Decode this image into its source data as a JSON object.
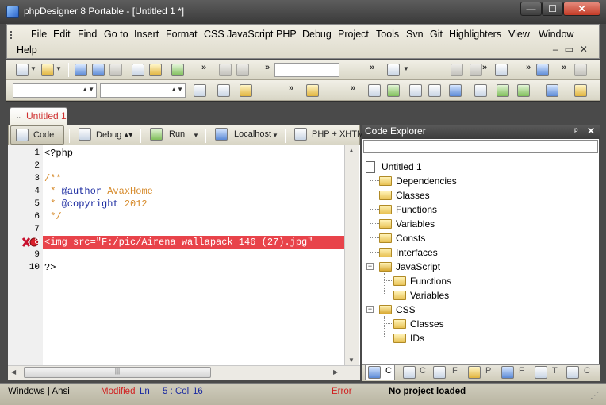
{
  "window": {
    "title": "phpDesigner 8 Portable - [Untitled 1 *]"
  },
  "menu": {
    "items": [
      "File",
      "Edit",
      "Find",
      "Go to",
      "Insert",
      "Format",
      "CSS",
      "JavaScript",
      "PHP",
      "Debug",
      "Project",
      "Tools",
      "Svn",
      "Git",
      "Highlighters",
      "View",
      "Window"
    ],
    "help": "Help"
  },
  "doc_tab": {
    "label": "Untitled 1"
  },
  "editor_toolbar": {
    "code": "Code",
    "debug": "Debug",
    "run": "Run",
    "localhost": "Localhost",
    "php_xhtml": "PHP + XHTM"
  },
  "editor": {
    "line_numbers": [
      "1",
      "2",
      "3",
      "4",
      "5",
      "6",
      "7",
      "8",
      "9",
      "10"
    ],
    "lines": [
      "<?php",
      "",
      "/**",
      " * @author AvaxHome",
      " * @copyright 2012",
      " */",
      "",
      "<img src=\"F:/pic/Airena wallapack 146 (27).jpg\"",
      "",
      "?>"
    ],
    "line4_tag": "@author",
    "line4_val": "AvaxHome",
    "line5_tag": "@copyright",
    "line5_val": "2012",
    "error_line": 8,
    "colors": {
      "comment": "#d68a2a",
      "keyword": "#1a2aa0",
      "error_bg": "#e8434a"
    }
  },
  "explorer": {
    "title": "Code Explorer",
    "root": "Untitled 1",
    "php_items": [
      "Dependencies",
      "Classes",
      "Functions",
      "Variables",
      "Consts",
      "Interfaces"
    ],
    "javascript": {
      "label": "JavaScript",
      "children": [
        "Functions",
        "Variables"
      ]
    },
    "css": {
      "label": "CSS",
      "children": [
        "Classes",
        "IDs"
      ]
    },
    "tabs": [
      "C",
      "C",
      "F",
      "P",
      "F",
      "T",
      "C"
    ]
  },
  "status": {
    "encoding": "Windows | Ansi",
    "modified": "Modified",
    "ln_label": "Ln",
    "position": "5 : Col",
    "col": "16",
    "error": "Error",
    "project": "No project loaded"
  }
}
